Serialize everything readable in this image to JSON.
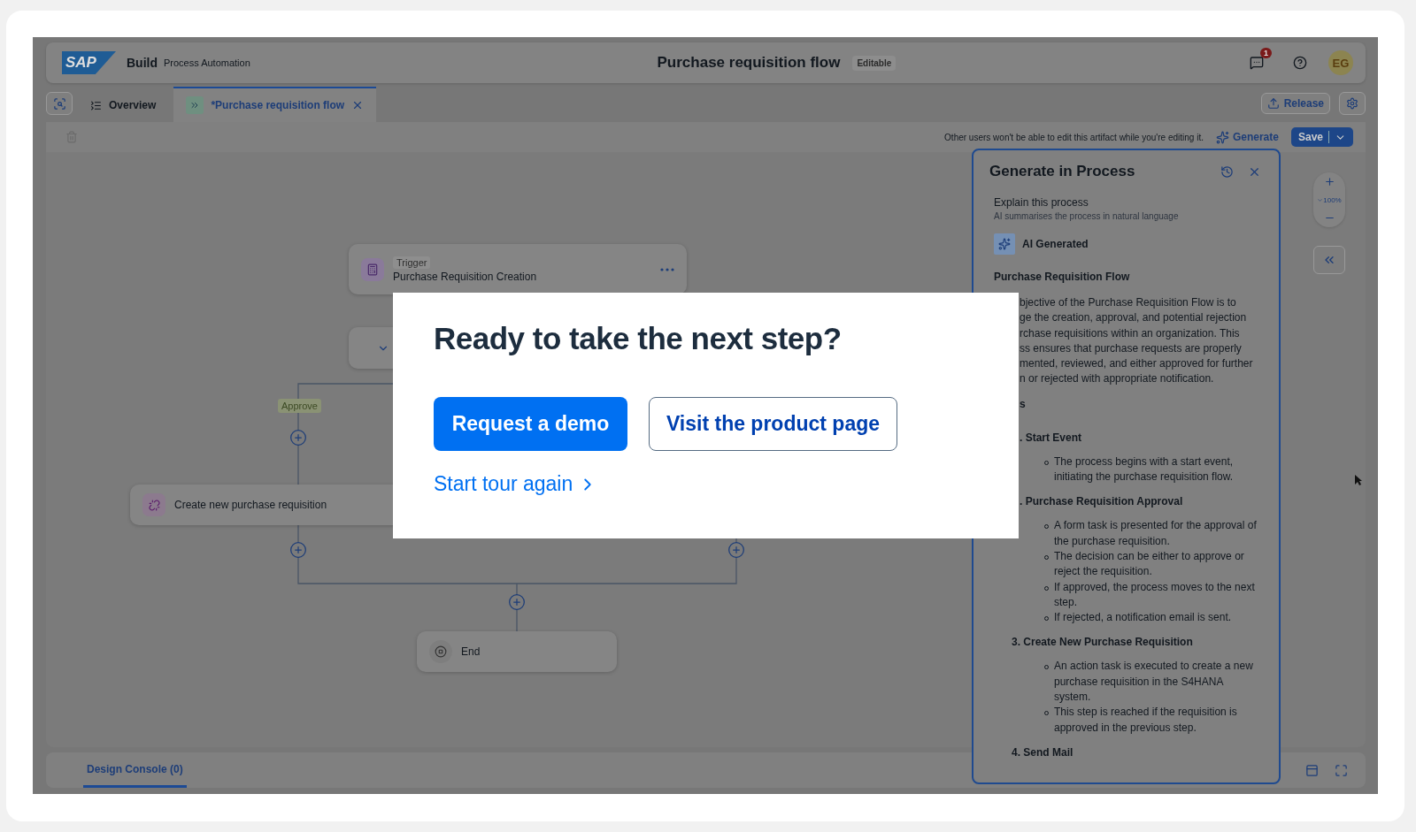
{
  "header": {
    "logo": "SAP",
    "product": "Build",
    "subtitle": "Process Automation",
    "title": "Purchase requisition flow",
    "badge": "Editable",
    "notification_count": "1",
    "avatar": "EG"
  },
  "tabs": [
    {
      "label": "Overview",
      "selected": false,
      "closable": false
    },
    {
      "label": "*Purchase requisition flow",
      "selected": true,
      "closable": true
    }
  ],
  "release": "Release",
  "toolbar": {
    "message": "Other users won't be able to edit this artifact while you're editing it.",
    "generate": "Generate",
    "save": "Save"
  },
  "canvas": {
    "trigger_tag": "Trigger",
    "trigger_title": "Purchase Requisition Creation",
    "branch_label": "Approve",
    "task": "Create new purchase requisition",
    "end": "End"
  },
  "zoom": "100%",
  "panel": {
    "title": "Generate in Process",
    "action_title": "Explain this process",
    "action_hint": "AI summarises the process in natural language",
    "ai_label": "AI Generated",
    "blocks": [
      {
        "kind": "heading",
        "text": "Purchase Requisition Flow"
      },
      {
        "kind": "line",
        "text": "bjective of the Purchase Requisition Flow is to"
      },
      {
        "kind": "line",
        "text": "ge the creation, approval, and potential rejection"
      },
      {
        "kind": "line",
        "text": "rchase requisitions within an organization. This"
      },
      {
        "kind": "line",
        "text": "ss ensures that purchase requests are properly"
      },
      {
        "kind": "line",
        "text": "mented, reviewed, and either approved for further"
      },
      {
        "kind": "line",
        "text": "n or rejected with appropriate notification."
      },
      {
        "kind": "cut-heading",
        "text": "s"
      },
      {
        "kind": "cut-heading",
        "text": ". Start Event"
      },
      {
        "kind": "bullet",
        "text": "The process begins with a start event, initiating the purchase requisition flow."
      },
      {
        "kind": "cut-heading",
        "text": ". Purchase Requisition Approval"
      },
      {
        "kind": "bullet",
        "text": "A form task is presented for the approval of the purchase requisition."
      },
      {
        "kind": "bullet",
        "text": "The decision can be either to approve or reject the requisition."
      },
      {
        "kind": "bullet",
        "text": "If approved, the process moves to the next step."
      },
      {
        "kind": "bullet",
        "text": "If rejected, a notification email is sent."
      },
      {
        "kind": "step",
        "text": "3. Create New Purchase Requisition"
      },
      {
        "kind": "bullet",
        "text": "An action task is executed to create a new purchase requisition in the S4HANA system."
      },
      {
        "kind": "bullet",
        "text": "This step is reached if the requisition is approved in the previous step."
      },
      {
        "kind": "step",
        "text": "4. Send Mail"
      }
    ]
  },
  "console": {
    "tab": "Design Console (0)",
    "selected": true
  },
  "modal": {
    "title": "Ready to take the next step?",
    "primary": "Request a demo",
    "secondary": "Visit the product page",
    "link": "Start tour again"
  }
}
